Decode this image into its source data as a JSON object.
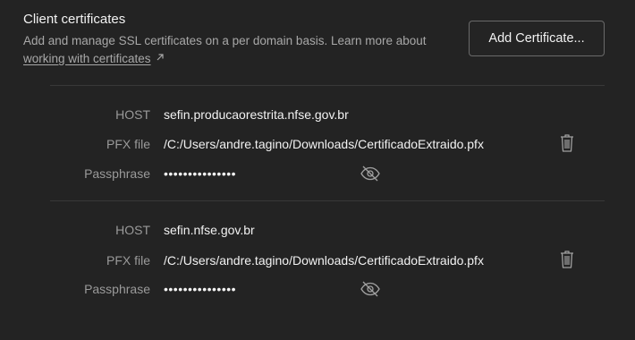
{
  "section": {
    "title": "Client certificates",
    "description": "Add and manage SSL certificates on a per domain basis. Learn more about",
    "link_text": "working with certificates",
    "add_button_label": "Add Certificate..."
  },
  "labels": {
    "host": "HOST",
    "pfx": "PFX file",
    "passphrase": "Passphrase"
  },
  "certificates": [
    {
      "host": "sefin.producaorestrita.nfse.gov.br",
      "pfx_file": "/C:/Users/andre.tagino/Downloads/CertificadoExtraido.pfx",
      "passphrase_masked": "•••••••••••••••"
    },
    {
      "host": "sefin.nfse.gov.br",
      "pfx_file": "/C:/Users/andre.tagino/Downloads/CertificadoExtraido.pfx",
      "passphrase_masked": "•••••••••••••••"
    }
  ],
  "icons": {
    "external_link": "external-link-icon",
    "trash": "trash-icon",
    "eye_hidden": "eye-off-icon"
  },
  "colors": {
    "background": "#232323",
    "text_primary": "#f2f2f2",
    "text_secondary": "#9a9a9a",
    "border": "#6a6a6a"
  }
}
